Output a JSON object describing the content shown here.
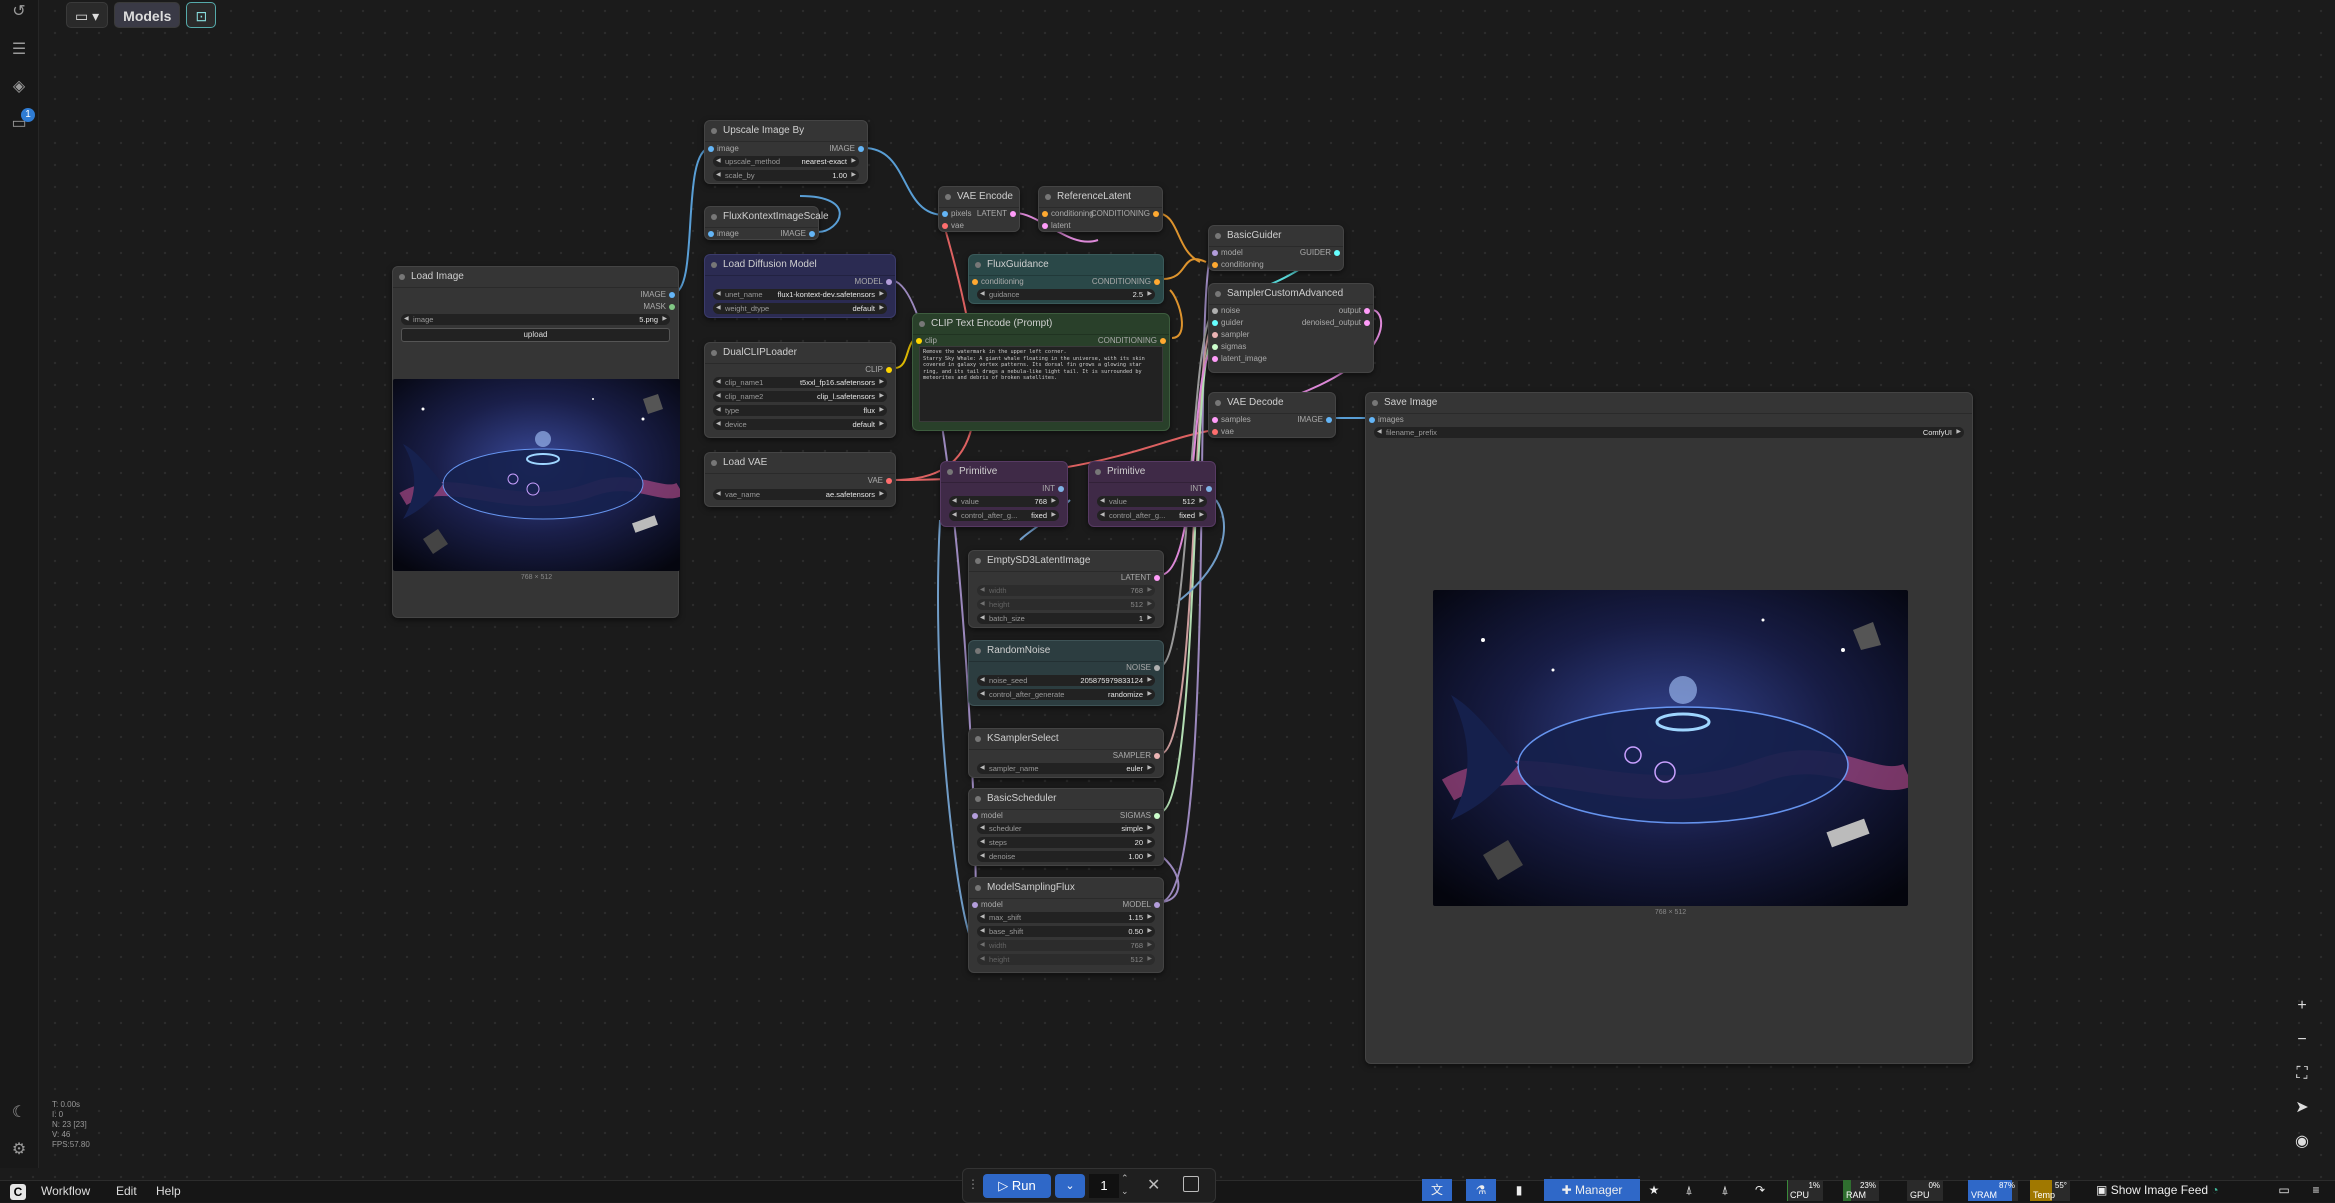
{
  "topbar": {
    "models_label": "Models"
  },
  "sidebar": {
    "queue_badge": "1"
  },
  "nodes": {
    "load_image": {
      "title": "Load Image",
      "out_image": "IMAGE",
      "out_mask": "MASK",
      "w_image_label": "image",
      "w_image_value": "5.png",
      "upload": "upload",
      "dims": "768 × 512"
    },
    "upscale": {
      "title": "Upscale Image By",
      "in_image": "image",
      "out_image": "IMAGE",
      "w1_label": "upscale_method",
      "w1_value": "nearest-exact",
      "w2_label": "scale_by",
      "w2_value": "1.00"
    },
    "flux_scale": {
      "title": "FluxKontextImageScale",
      "in_image": "image",
      "out_image": "IMAGE"
    },
    "load_diffusion": {
      "title": "Load Diffusion Model",
      "out_model": "MODEL",
      "w1_label": "unet_name",
      "w1_value": "flux1-kontext-dev.safetensors",
      "w2_label": "weight_dtype",
      "w2_value": "default"
    },
    "dual_clip": {
      "title": "DualCLIPLoader",
      "out_clip": "CLIP",
      "w1_label": "clip_name1",
      "w1_value": "t5xxl_fp16.safetensors",
      "w2_label": "clip_name2",
      "w2_value": "clip_l.safetensors",
      "w3_label": "type",
      "w3_value": "flux",
      "w4_label": "device",
      "w4_value": "default"
    },
    "load_vae": {
      "title": "Load VAE",
      "out_vae": "VAE",
      "w1_label": "vae_name",
      "w1_value": "ae.safetensors"
    },
    "vae_encode": {
      "title": "VAE Encode",
      "in_pixels": "pixels",
      "in_vae": "vae",
      "out_latent": "LATENT"
    },
    "reference_latent": {
      "title": "ReferenceLatent",
      "in_conditioning": "conditioning",
      "in_latent": "latent",
      "out_conditioning": "CONDITIONING"
    },
    "flux_guidance": {
      "title": "FluxGuidance",
      "in_conditioning": "conditioning",
      "out_conditioning": "CONDITIONING",
      "w1_label": "guidance",
      "w1_value": "2.5"
    },
    "clip_text": {
      "title": "CLIP Text Encode (Prompt)",
      "in_clip": "clip",
      "out_conditioning": "CONDITIONING",
      "prompt": "Remove the watermark in the upper left corner.\nStarry Sky Whale: A giant whale floating in the universe, with its skin covered in galaxy vortex patterns. Its dorsal fin grows a glowing star ring, and its tail drags a nebula-like light tail. It is surrounded by meteorites and debris of broken satellites."
    },
    "basic_guider": {
      "title": "BasicGuider",
      "in_model": "model",
      "in_conditioning": "conditioning",
      "out_guider": "GUIDER"
    },
    "sampler_custom": {
      "title": "SamplerCustomAdvanced",
      "in_noise": "noise",
      "in_guider": "guider",
      "in_sampler": "sampler",
      "in_sigmas": "sigmas",
      "in_latent": "latent_image",
      "out_output": "output",
      "out_denoised": "denoised_output"
    },
    "vae_decode": {
      "title": "VAE Decode",
      "in_samples": "samples",
      "in_vae": "vae",
      "out_image": "IMAGE"
    },
    "save_image": {
      "title": "Save Image",
      "in_images": "images",
      "w1_label": "filename_prefix",
      "w1_value": "ComfyUI",
      "dims": "768 × 512"
    },
    "primitive1": {
      "title": "Primitive",
      "out_int": "INT",
      "w1_label": "value",
      "w1_value": "768",
      "w2_label": "control_after_g...",
      "w2_value": "fixed"
    },
    "primitive2": {
      "title": "Primitive",
      "out_int": "INT",
      "w1_label": "value",
      "w1_value": "512",
      "w2_label": "control_after_g...",
      "w2_value": "fixed"
    },
    "empty_latent": {
      "title": "EmptySD3LatentImage",
      "out_latent": "LATENT",
      "w1_label": "width",
      "w1_value": "768",
      "w2_label": "height",
      "w2_value": "512",
      "w3_label": "batch_size",
      "w3_value": "1"
    },
    "random_noise": {
      "title": "RandomNoise",
      "out_noise": "NOISE",
      "w1_label": "noise_seed",
      "w1_value": "205875979833124",
      "w2_label": "control_after_generate",
      "w2_value": "randomize"
    },
    "ksampler_select": {
      "title": "KSamplerSelect",
      "out_sampler": "SAMPLER",
      "w1_label": "sampler_name",
      "w1_value": "euler"
    },
    "basic_scheduler": {
      "title": "BasicScheduler",
      "in_model": "model",
      "out_sigmas": "SIGMAS",
      "w1_label": "scheduler",
      "w1_value": "simple",
      "w2_label": "steps",
      "w2_value": "20",
      "w3_label": "denoise",
      "w3_value": "1.00"
    },
    "model_sampling": {
      "title": "ModelSamplingFlux",
      "in_model": "model",
      "out_model": "MODEL",
      "w1_label": "max_shift",
      "w1_value": "1.15",
      "w2_label": "base_shift",
      "w2_value": "0.50",
      "w3_label": "width",
      "w3_value": "768",
      "w4_label": "height",
      "w4_value": "512"
    }
  },
  "stats": {
    "t": "T: 0.00s",
    "i": "I: 0",
    "n": "N: 23 [23]",
    "v": "V: 46",
    "fps": "FPS:57.80"
  },
  "bottom": {
    "workflow": "Workflow",
    "edit": "Edit",
    "help": "Help",
    "run": "Run",
    "run_count": "1",
    "manager": "Manager",
    "show_feed": "Show Image Feed"
  },
  "monitor": {
    "cpu": {
      "label": "CPU",
      "value": "1%",
      "level": 1
    },
    "ram": {
      "label": "RAM",
      "value": "23%",
      "level": 23
    },
    "gpu": {
      "label": "GPU",
      "value": "0%",
      "level": 0
    },
    "vram": {
      "label": "VRAM",
      "value": "87%",
      "level": 87
    },
    "temp": {
      "label": "Temp",
      "value": "55°",
      "level": 55
    }
  },
  "colors": {
    "image": "#64b5f6",
    "latent": "#ff9cf9",
    "conditioning": "#ffa931",
    "model": "#b39ddb",
    "clip": "#ffd500",
    "vae": "#ff6e6e",
    "int": "#7fb3e6",
    "sampler": "#ecb4b4",
    "sigmas": "#cdffcd",
    "noise": "#b0b0b0",
    "guider": "#66ffff"
  }
}
